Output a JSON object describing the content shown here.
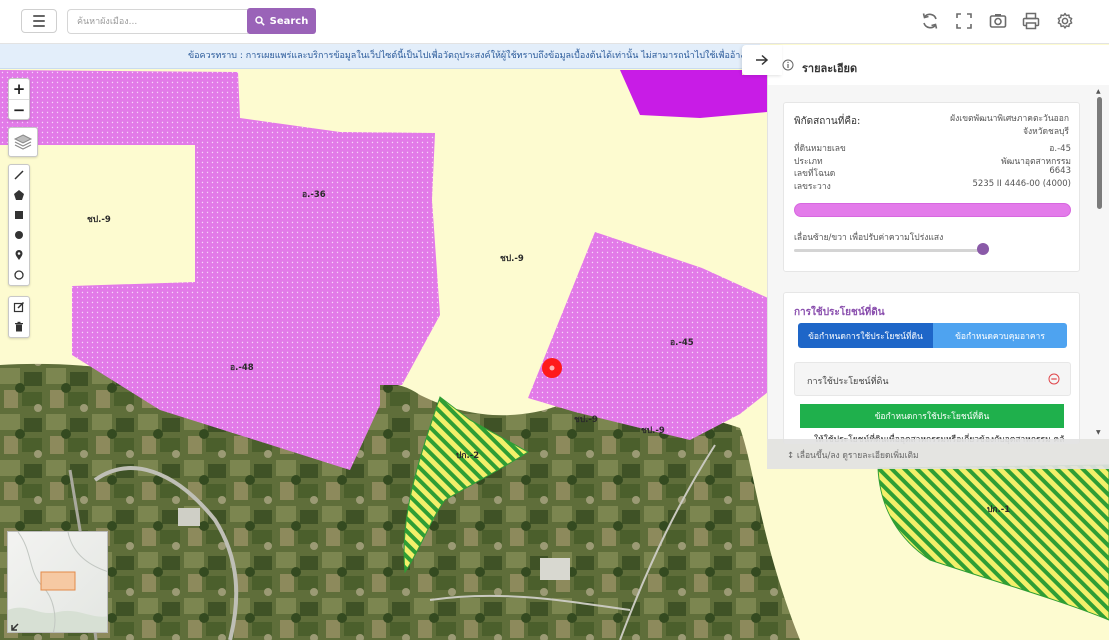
{
  "header": {
    "search_placeholder": "ค้นหาผังเมือง...",
    "search_label": "Search",
    "icons": [
      "hamburger-menu-icon",
      "refresh-icon",
      "fullscreen-icon",
      "screenshot-icon",
      "print-icon",
      "gear-icon"
    ]
  },
  "disclaimer": {
    "text": "ข้อควรทราบ : การเผยแพร่และบริการข้อมูลในเว็ปไซต์นี้เป็นไปเพื่อวัตถุประสงค์ให้ผู้ใช้ทราบถึงข้อมูลเบื้องต้นได้เท่านั้น ไม่สามารถนำไปใช้เพื่ออ้างอิงทางกฎหมาย"
  },
  "map": {
    "labels": {
      "o36": "อ.-36",
      "chp9_left": "ชป.-9",
      "chp9_center": "ชป.-9",
      "o48": "อ.-48",
      "o45": "อ.-45",
      "chp9_lower": "ชป.-9",
      "chp9_lower2": "ชป.-9",
      "pk2": "ปก.-2",
      "pk1": "ปก.-1"
    },
    "colors": {
      "base": "#fdfbd0",
      "industrial": "#e27ae8",
      "industrial_dark": "#c81ce6",
      "conservation_green": "#2f9e35",
      "conservation_yellow": "#f3f06a",
      "marker": "#ff1a1a"
    },
    "zoom_in": "+",
    "zoom_out": "−"
  },
  "panel": {
    "title": "รายละเอียด",
    "coord_label": "พิกัดสถานที่คือ:",
    "coord_value_line1": "ผังเขตพัฒนาพิเศษภาคตะวันออก",
    "coord_value_line2": "จังหวัดชลบุรี",
    "rows": [
      {
        "key": "ที่ดินหมายเลข",
        "value": "อ.-45"
      },
      {
        "key": "ประเภท",
        "value": "พัฒนาอุตสาหกรรม"
      },
      {
        "key": "เลขที่โฉนด",
        "value": "6643"
      },
      {
        "key": "เลขระวาง",
        "value": "5235 II 4446-00 (4000)"
      }
    ],
    "slider_label": "เลื่อนซ้าย/ขวา เพื่อปรับค่าความโปร่งแสง",
    "opacity": 0.97,
    "land_use_title": "การใช้ประโยชน์ที่ดิน",
    "tab1": "ข้อกำหนดการใช้ประโยชน์ที่ดิน",
    "tab2": "ข้อกำหนดควบคุมอาคาร",
    "accordion_title": "การใช้ประโยชน์ที่ดิน",
    "green_bar": "ข้อกำหนดการใช้ประโยชน์ที่ดิน",
    "green_desc": "ให้ใช้ประโยชน์ที่ดินเพื่ออุตสาหกรรมหรือเกี่ยวข้องกับอุตสาหกรรม คลัง",
    "footer": "↕ เลื่อนขึ้น/ลง ดูรายละเอียดเพิ่มเติม"
  }
}
